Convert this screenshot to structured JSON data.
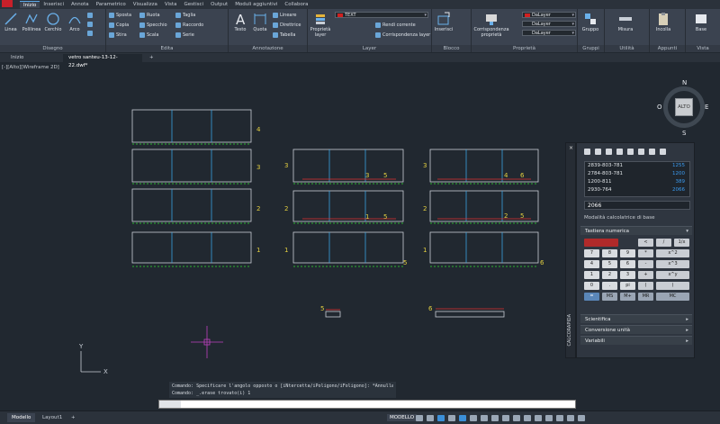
{
  "menubar": {
    "tabs": [
      "Inizio",
      "Inserisci",
      "Annota",
      "Parametrico",
      "Visualizza",
      "Vista",
      "Gestisci",
      "Output",
      "Moduli aggiuntivi",
      "Collabora"
    ],
    "active_tab": "Inizio"
  },
  "ribbon": {
    "disegno": {
      "title": "Disegno",
      "big": [
        "Linea",
        "Polilinea",
        "Cerchio",
        "Arco"
      ]
    },
    "edita": {
      "title": "Edita",
      "col1": [
        "Sposta",
        "Copia",
        "Stira"
      ],
      "col2": [
        "Ruota",
        "Specchio",
        "Scala"
      ],
      "col3": [
        "Taglia",
        "Raccordo",
        "Serie"
      ]
    },
    "annotazione": {
      "title": "Annotazione",
      "big": [
        "Testo",
        "Quota"
      ],
      "small": [
        "Lineare",
        "Direttrice",
        "Tabella"
      ]
    },
    "layer": {
      "title": "Layer",
      "big": "Proprietà layer",
      "layer_combo": "TEXT",
      "small": [
        "Rendi corrente",
        "Corrispondenza layer"
      ]
    },
    "blocco": {
      "title": "Blocco",
      "big": "Inserisci"
    },
    "proprieta": {
      "title": "Proprietà",
      "big": "Corrispondenza proprietà",
      "combos": [
        "DaLayer",
        "DaLayer",
        "DaLayer"
      ]
    },
    "gruppi": {
      "title": "Gruppi",
      "big": "Gruppo"
    },
    "utilita": {
      "title": "Utilità",
      "big": "Misura"
    },
    "appunti": {
      "title": "Appunti",
      "big": "Incolla"
    },
    "vista": {
      "title": "Vista",
      "big": "Base"
    }
  },
  "doctabs": {
    "start": "Inizio",
    "file": "vetro santeu-13-12-22.dwf*"
  },
  "viewport_label": "[-][Alto][Wireframe 2D]",
  "viewcube": {
    "face": "ALTO",
    "n": "N",
    "s": "S",
    "e": "E",
    "o": "O"
  },
  "drawing": {
    "left_labels": [
      "4",
      "3",
      "2",
      "1"
    ],
    "mid_labels": [
      "3",
      "2",
      "1"
    ],
    "mid_inner": [
      "3",
      "5",
      "1",
      "5"
    ],
    "mid_right": "5",
    "right_inner": [
      "4",
      "6",
      "2",
      "5"
    ],
    "right_edge": "6",
    "bottom_left": "5",
    "bottom_right": "6"
  },
  "calculator": {
    "vertical_label": "CALCORAPIDA",
    "history": [
      {
        "expr": "2839-803-781",
        "res": "1255"
      },
      {
        "expr": "2784-803-781",
        "res": "1200"
      },
      {
        "expr": "1200-811",
        "res": "389"
      },
      {
        "expr": "2930-764",
        "res": "2066"
      }
    ],
    "input_value": "2066",
    "mode": "Modalità calcolatrice di base",
    "sections": {
      "keypad": "Tastiera numerica",
      "scientific": "Scientifica",
      "units": "Conversione unità",
      "variables": "Variabili"
    },
    "keys": [
      [
        "",
        "",
        "<",
        "/",
        "1/x"
      ],
      [
        "7",
        "8",
        "9",
        "*",
        "x^2"
      ],
      [
        "4",
        "5",
        "6",
        "-",
        "x^3"
      ],
      [
        "1",
        "2",
        "3",
        "+",
        "x^y"
      ],
      [
        "0",
        ".",
        "pi",
        "(",
        ")"
      ],
      [
        "=",
        "MS",
        "M+",
        "MR",
        "MC"
      ]
    ]
  },
  "command": {
    "history": [
      "Comando: Specificare l'angolo opposto o [iNtercetta/iPoligono/iFoligono]: *Annulla*",
      "Comando: _.erase trovato(i) 1"
    ],
    "placeholder": ""
  },
  "status": {
    "tabs": [
      "Modello",
      "Layout1"
    ],
    "active": "Modello",
    "mode": "MODELLO"
  }
}
